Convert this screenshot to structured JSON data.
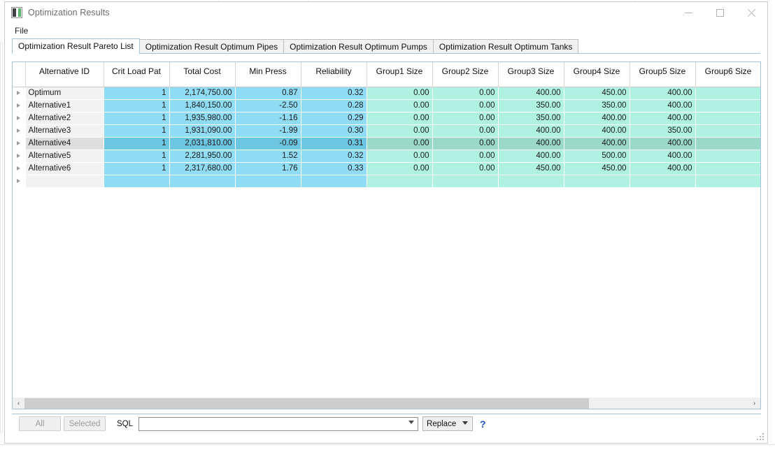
{
  "window": {
    "title": "Optimization Results",
    "icon": "app-icon",
    "controls": [
      {
        "name": "minimize",
        "glyph": "minimize-icon"
      },
      {
        "name": "maximize",
        "glyph": "maximize-icon"
      },
      {
        "name": "close",
        "glyph": "close-icon"
      }
    ]
  },
  "menubar": {
    "items": [
      {
        "label": "File"
      }
    ]
  },
  "tabs": [
    {
      "label": "Optimization Result Pareto List",
      "active": true
    },
    {
      "label": "Optimization Result Optimum Pipes",
      "active": false
    },
    {
      "label": "Optimization Result Optimum Pumps",
      "active": false
    },
    {
      "label": "Optimization Result Optimum Tanks",
      "active": false
    }
  ],
  "grid": {
    "columns": [
      "Alternative ID",
      "Crit Load Pat",
      "Total Cost",
      "Min Press",
      "Reliability",
      "Group1 Size",
      "Group2 Size",
      "Group3 Size",
      "Group4 Size",
      "Group5 Size",
      "Group6 Size"
    ],
    "rows": [
      {
        "selected": false,
        "cells": [
          "Optimum",
          "1",
          "2,174,750.00",
          "0.87",
          "0.32",
          "0.00",
          "0.00",
          "400.00",
          "450.00",
          "400.00",
          ""
        ]
      },
      {
        "selected": false,
        "cells": [
          "Alternative1",
          "1",
          "1,840,150.00",
          "-2.50",
          "0.28",
          "0.00",
          "0.00",
          "350.00",
          "350.00",
          "400.00",
          ""
        ]
      },
      {
        "selected": false,
        "cells": [
          "Alternative2",
          "1",
          "1,935,980.00",
          "-1.16",
          "0.29",
          "0.00",
          "0.00",
          "350.00",
          "400.00",
          "400.00",
          ""
        ]
      },
      {
        "selected": false,
        "cells": [
          "Alternative3",
          "1",
          "1,931,090.00",
          "-1.99",
          "0.30",
          "0.00",
          "0.00",
          "400.00",
          "400.00",
          "350.00",
          ""
        ]
      },
      {
        "selected": true,
        "cells": [
          "Alternative4",
          "1",
          "2,031,810.00",
          "-0.09",
          "0.31",
          "0.00",
          "0.00",
          "400.00",
          "400.00",
          "400.00",
          ""
        ]
      },
      {
        "selected": false,
        "cells": [
          "Alternative5",
          "1",
          "2,281,950.00",
          "1.52",
          "0.32",
          "0.00",
          "0.00",
          "400.00",
          "500.00",
          "400.00",
          ""
        ]
      },
      {
        "selected": false,
        "cells": [
          "Alternative6",
          "1",
          "2,317,680.00",
          "1.76",
          "0.33",
          "0.00",
          "0.00",
          "450.00",
          "450.00",
          "400.00",
          ""
        ]
      },
      {
        "selected": false,
        "cells": [
          "",
          "",
          "",
          "",
          "",
          "",
          "",
          "",
          "",
          "",
          ""
        ]
      }
    ]
  },
  "scrollbar": {
    "left_arrow": "‹",
    "right_arrow": "›",
    "thumb_fraction": "78%"
  },
  "bottom_toolbar": {
    "all_label": "All",
    "selected_label": "Selected",
    "sql_label": "SQL",
    "sql_value": "",
    "sql_placeholder": "",
    "mode_value": "Replace",
    "mode_options": [
      "Replace"
    ],
    "help_label": "?"
  },
  "colors": {
    "blue_cell": "#8fdcf4",
    "blue_cell_selected": "#6cc6e2",
    "green_cell": "#b0f2e1",
    "green_cell_selected": "#9ad9c8",
    "name_cell": "#f2f2f2",
    "name_cell_selected": "#dedede",
    "grid_border": "#a6c4d8",
    "help_blue": "#1f53c4"
  }
}
